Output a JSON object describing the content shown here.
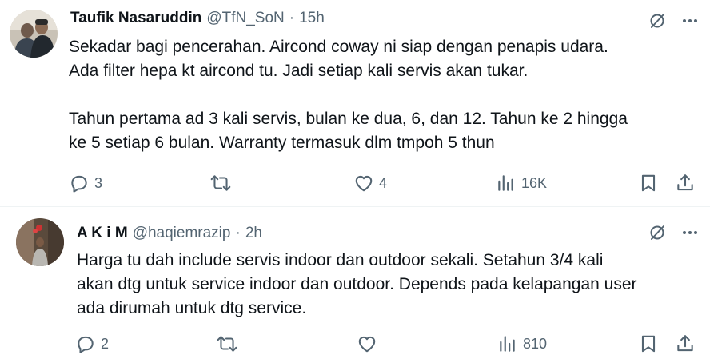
{
  "tweets": [
    {
      "name": "Taufik Nasaruddin",
      "handle": "@TfN_SoN",
      "separator": "·",
      "time": "15h",
      "text": "Sekadar bagi pencerahan. Aircond coway ni siap dengan penapis udara.\nAda filter hepa kt aircond tu. Jadi setiap kali servis akan tukar.\n\nTahun pertama ad 3 kali servis, bulan ke dua, 6, dan 12. Tahun ke 2 hingga\nke 5 setiap 6 bulan. Warranty termasuk dlm tmpoh 5 thun",
      "replies": "3",
      "reposts": "",
      "likes": "4",
      "views": "16K"
    },
    {
      "name": "A K i M",
      "handle": "@haqiemrazip",
      "separator": "·",
      "time": "2h",
      "text": "Harga tu dah include servis indoor dan outdoor sekali. Setahun 3/4 kali\nakan dtg untuk service indoor dan outdoor. Depends pada kelapangan user\nada dirumah untuk dtg service.",
      "replies": "2",
      "reposts": "",
      "likes": "",
      "views": "810"
    }
  ],
  "icons": {
    "reply": "reply-icon",
    "repost": "repost-icon",
    "like": "like-icon",
    "views": "views-icon",
    "bookmark": "bookmark-icon",
    "share": "share-icon",
    "grok": "grok-icon",
    "more": "more-icon"
  },
  "colors": {
    "text": "#0f1419",
    "secondary": "#536471",
    "divider": "#eff3f4"
  }
}
